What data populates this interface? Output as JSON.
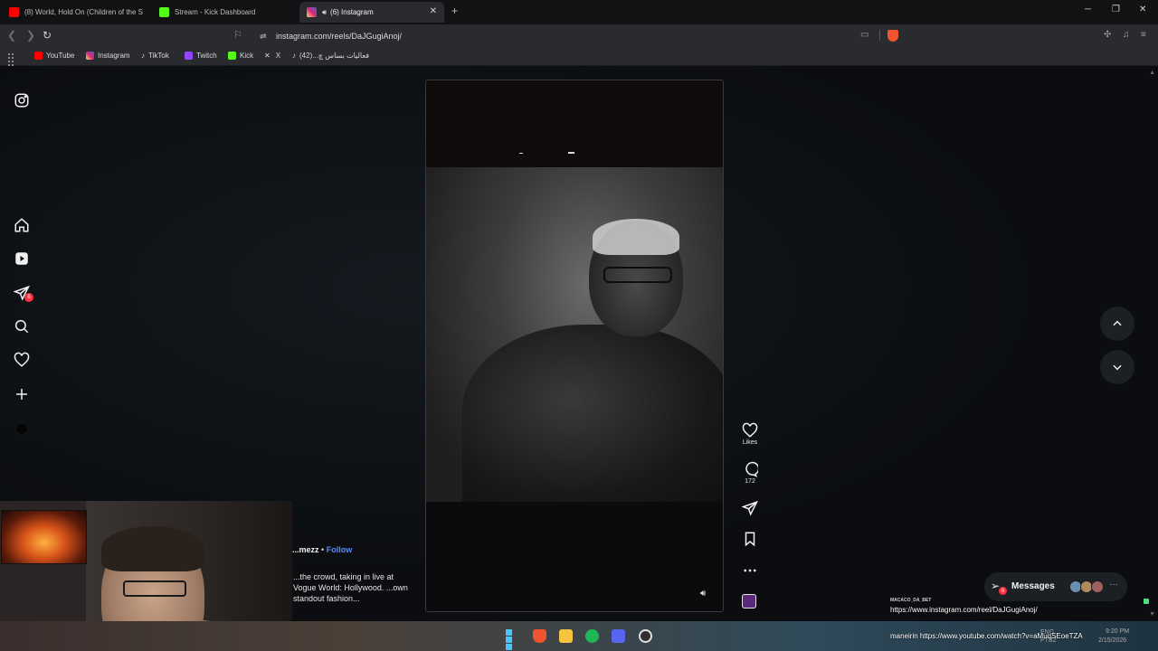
{
  "tabs": [
    {
      "title": "(8) World, Hold On (Children of the S",
      "icon": "youtube-icon",
      "color": "#ff0000",
      "active": false
    },
    {
      "title": "Stream - Kick Dashboard",
      "icon": "kick-icon",
      "color": "#53fc18",
      "active": false
    },
    {
      "title": "(6) Instagram",
      "icon": "instagram-icon",
      "color": "#d62976",
      "active": true
    }
  ],
  "address": {
    "url": "instagram.com/reels/DaJGugiAnoj/"
  },
  "bookmarks": [
    {
      "label": "YouTube",
      "icon": "youtube-icon",
      "color": "#ff0000"
    },
    {
      "label": "Instagram",
      "icon": "instagram-icon",
      "color": "#d62976"
    },
    {
      "label": "TikTok",
      "icon": "tiktok-icon",
      "color": "#ffffff"
    },
    {
      "label": "Twitch",
      "icon": "twitch-icon",
      "color": "#9146ff"
    },
    {
      "label": "Kick",
      "icon": "kick-icon",
      "color": "#53fc18"
    },
    {
      "label": "X",
      "icon": "x-icon",
      "color": "#ffffff"
    },
    {
      "label": "فعالیات بساس چ...(42)",
      "icon": "tiktok-icon",
      "color": "#ffffff"
    }
  ],
  "sidebar": {
    "notification_count": "6"
  },
  "reel": {
    "likes_label": "Likes",
    "comments_count": "172",
    "caption_user": "...mezz",
    "caption_separator": "•",
    "follow_label": "Follow",
    "caption_text": "...the crowd, taking in live at Vogue World: Hollywood. ...own standout fashion..."
  },
  "messages": {
    "label": "Messages",
    "badge": "6"
  },
  "chat": {
    "name1": "MACACO_DA_BET",
    "msg1": "https://www.instagram.com/reel/DaJGugiAnoj/",
    "msg2": "maneirin https://www.youtube.com/watch?v=aMuqSEoeTZA"
  },
  "tray": {
    "lang": "ENG",
    "region": "PTB2",
    "time": "9:20 PM",
    "date": "2/15/2026"
  },
  "colors": {
    "accent": "#5b8cff",
    "badge": "#ff3040",
    "page_bg": "#0b0d10"
  }
}
